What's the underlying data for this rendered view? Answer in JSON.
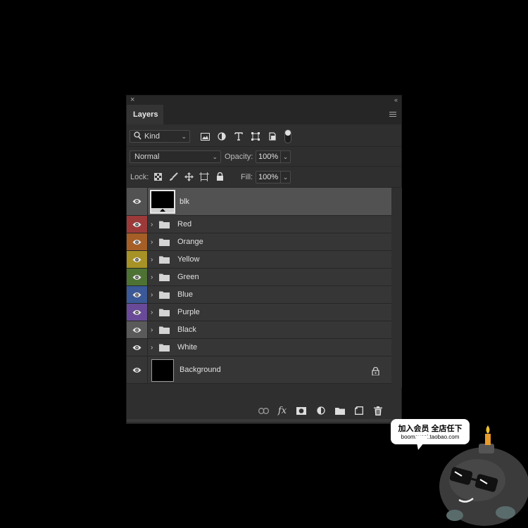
{
  "panel": {
    "close_glyph": "×",
    "collapse_glyph": "‹‹",
    "tab_label": "Layers",
    "menu_icon": "panel-menu-icon"
  },
  "filter": {
    "kind_label": "Kind",
    "filter_icons": [
      "image-filter-icon",
      "adjustment-filter-icon",
      "type-filter-icon",
      "shape-filter-icon",
      "smart-object-filter-icon"
    ],
    "toggle_state": "on"
  },
  "blending": {
    "mode": "Normal",
    "opacity_label": "Opacity:",
    "opacity_value": "100%"
  },
  "locks": {
    "lock_label": "Lock:",
    "fill_label": "Fill:",
    "fill_value": "100%",
    "lock_icons": [
      "lock-transparent-pixels-icon",
      "lock-image-pixels-icon",
      "lock-position-icon",
      "lock-artboard-icon",
      "lock-all-icon"
    ]
  },
  "layers": [
    {
      "name": "blk",
      "type": "smart",
      "color": "",
      "selected": true
    },
    {
      "name": "Red",
      "type": "group",
      "color": "#9c3a3a"
    },
    {
      "name": "Orange",
      "type": "group",
      "color": "#a55e26"
    },
    {
      "name": "Yellow",
      "type": "group",
      "color": "#a69226"
    },
    {
      "name": "Green",
      "type": "group",
      "color": "#4e7233"
    },
    {
      "name": "Blue",
      "type": "group",
      "color": "#3b5996"
    },
    {
      "name": "Purple",
      "type": "group",
      "color": "#684a98"
    },
    {
      "name": "Black",
      "type": "group",
      "color": "#5a5a5a"
    },
    {
      "name": "White",
      "type": "group",
      "color": ""
    },
    {
      "name": "Background",
      "type": "background",
      "color": "",
      "locked": true
    }
  ],
  "bottom_toolbar": [
    "link-layers-icon",
    "fx-icon",
    "add-mask-icon",
    "adjustment-layer-icon",
    "new-group-icon",
    "new-layer-icon",
    "delete-layer-icon"
  ],
  "fx_label": "fx",
  "promo": {
    "line1": "加入会员 全店任下",
    "line2": "boomsucai.taobao.com"
  }
}
